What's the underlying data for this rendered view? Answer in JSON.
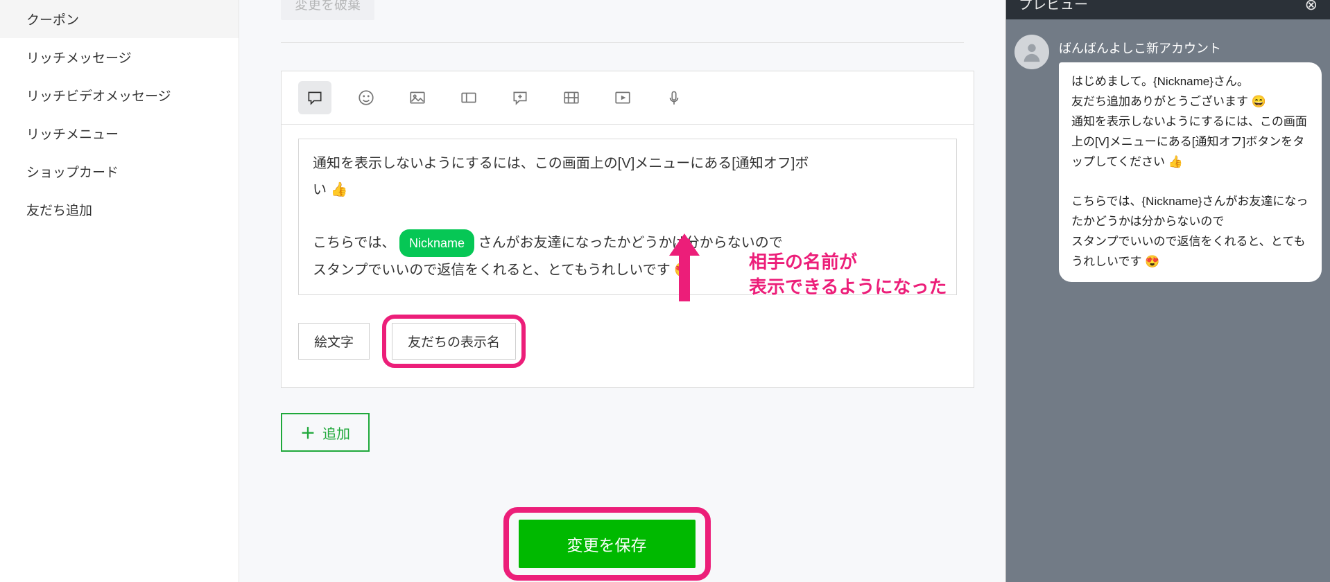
{
  "sidebar": {
    "items": [
      {
        "label": "クーポン"
      },
      {
        "label": "リッチメッセージ"
      },
      {
        "label": "リッチビデオメッセージ"
      },
      {
        "label": "リッチメニュー"
      },
      {
        "label": "ショップカード"
      },
      {
        "label": "友だち追加"
      }
    ]
  },
  "main": {
    "discard_label": "変更を破棄",
    "editor": {
      "line1": "通知を表示しないようにするには、この画面上の[V]メニューにある[通知オフ]ボ",
      "line1_tail": "い 👍",
      "line2_pre": "こちらでは、",
      "nickname_chip": "Nickname",
      "line2_mid": " さんがお友達になったかどうかは分からないので",
      "line3": "スタンプでいいので返信をくれると、とてもうれしいです 😍"
    },
    "emoji_btn": "絵文字",
    "friendname_btn": "友だちの表示名",
    "add_btn": "追加",
    "save_btn": "変更を保存",
    "annotation_line1": "相手の名前が",
    "annotation_line2": "表示できるようになった"
  },
  "preview": {
    "title": "プレビュー",
    "account_name": "ばんばんよしこ新アカウント",
    "bubble1_l1": "はじめまして。{Nickname}さん。",
    "bubble1_l2": "友だち追加ありがとうございます 😄",
    "bubble1_l3": "通知を表示しないようにするには、この画面上の[V]メニューにある[通知オフ]ボタンをタップしてください 👍",
    "bubble2": "こちらでは、{Nickname}さんがお友達になったかどうかは分からないので",
    "bubble3": "スタンプでいいので返信をくれると、とてもうれしいです 😍"
  }
}
